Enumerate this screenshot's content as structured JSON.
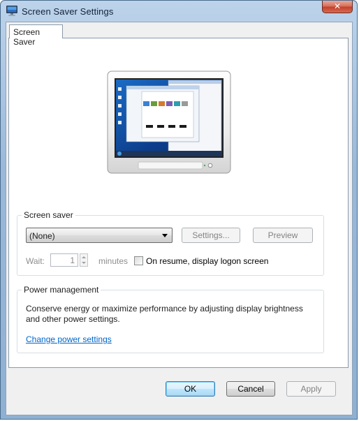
{
  "window": {
    "title": "Screen Saver Settings",
    "close_glyph": "✕",
    "icon": "screen-saver-settings-icon"
  },
  "tabs": [
    {
      "label": "Screen Saver",
      "selected": true
    }
  ],
  "screen_saver": {
    "group_label": "Screen saver",
    "selected": "(None)",
    "settings_label": "Settings...",
    "preview_label": "Preview",
    "wait_label": "Wait:",
    "wait_value": "1",
    "minutes_label": "minutes",
    "resume_label": "On resume, display logon screen",
    "resume_checked": false
  },
  "power": {
    "group_label": "Power management",
    "description": "Conserve energy or maximize performance by adjusting display brightness and other power settings.",
    "link_label": "Change power settings"
  },
  "buttons": {
    "ok": "OK",
    "cancel": "Cancel",
    "apply": "Apply"
  },
  "colors": {
    "link": "#0066cc",
    "default_button_border": "#3c7fb1",
    "title_bar": "#9ab9d9",
    "close_button": "#c2422c"
  }
}
